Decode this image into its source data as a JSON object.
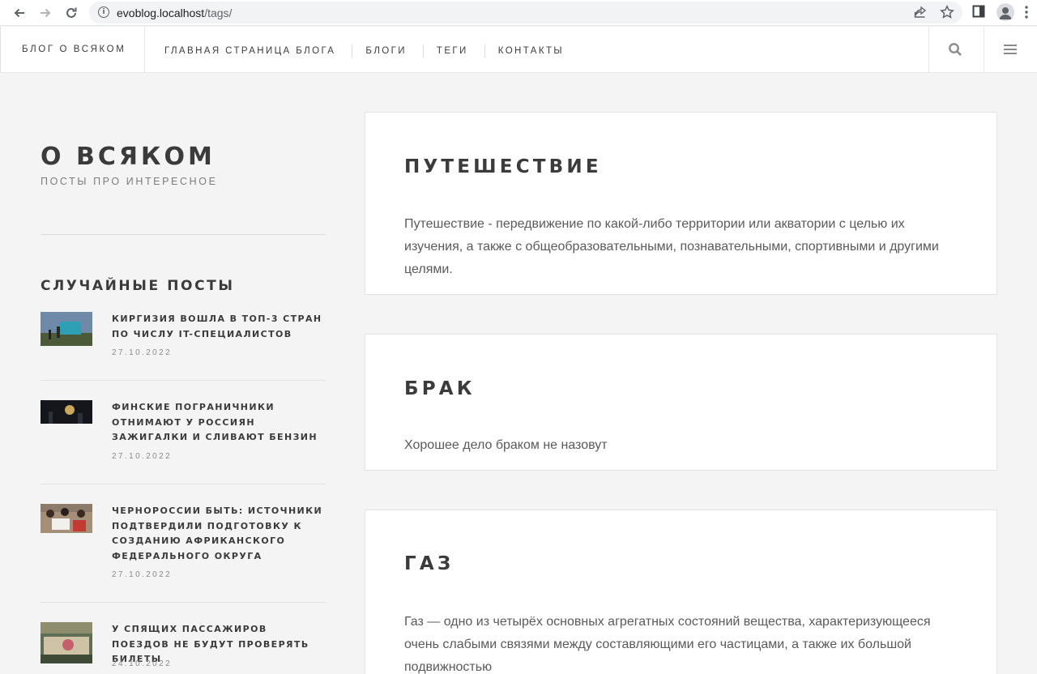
{
  "browser": {
    "url_host": "evoblog.localhost",
    "url_path": "/tags/"
  },
  "header": {
    "brand": "БЛОГ О ВСЯКОМ",
    "nav": [
      "ГЛАВНАЯ СТРАНИЦА БЛОГА",
      "БЛОГИ",
      "ТЕГИ",
      "КОНТАКТЫ"
    ]
  },
  "sidebar": {
    "title": "О ВСЯКОМ",
    "subtitle": "ПОСТЫ ПРО ИНТЕРЕСНОЕ",
    "random_title": "СЛУЧАЙНЫЕ ПОСТЫ",
    "posts": [
      {
        "title": "КИРГИЗИЯ ВОШЛА В ТОП-3 СТРАН ПО ЧИСЛУ IT-СПЕЦИАЛИСТОВ",
        "date": "27.10.2022"
      },
      {
        "title": "ФИНСКИЕ ПОГРАНИЧНИКИ ОТНИМАЮТ У РОССИЯН ЗАЖИГАЛКИ И СЛИВАЮТ БЕНЗИН",
        "date": "27.10.2022"
      },
      {
        "title": "ЧЕРНОРОССИИ БЫТЬ: ИСТОЧНИКИ ПОДТВЕРДИЛИ ПОДГОТОВКУ К СОЗДАНИЮ АФРИКАНСКОГО ФЕДЕРАЛЬНОГО ОКРУГА",
        "date": "27.10.2022"
      },
      {
        "title": "У СПЯЩИХ ПАССАЖИРОВ ПОЕЗДОВ НЕ БУДУТ ПРОВЕРЯТЬ БИЛЕТЫ",
        "date": "24.10.2022"
      }
    ]
  },
  "tags": [
    {
      "name": "ПУТЕШЕСТВИЕ",
      "description": "Путешествие - передвижение по какой-либо территории или акватории с целью их изучения, а также с общеобразовательными, познавательными, спортивными и другими целями."
    },
    {
      "name": "БРАК",
      "description": "Хорошее дело браком не назовут"
    },
    {
      "name": "ГАЗ",
      "description": "Газ — одно из четырёх основных агрегатных состояний вещества, характеризующееся очень слабыми связями между составляющими его частицами, а также их большой подвижностью"
    }
  ]
}
